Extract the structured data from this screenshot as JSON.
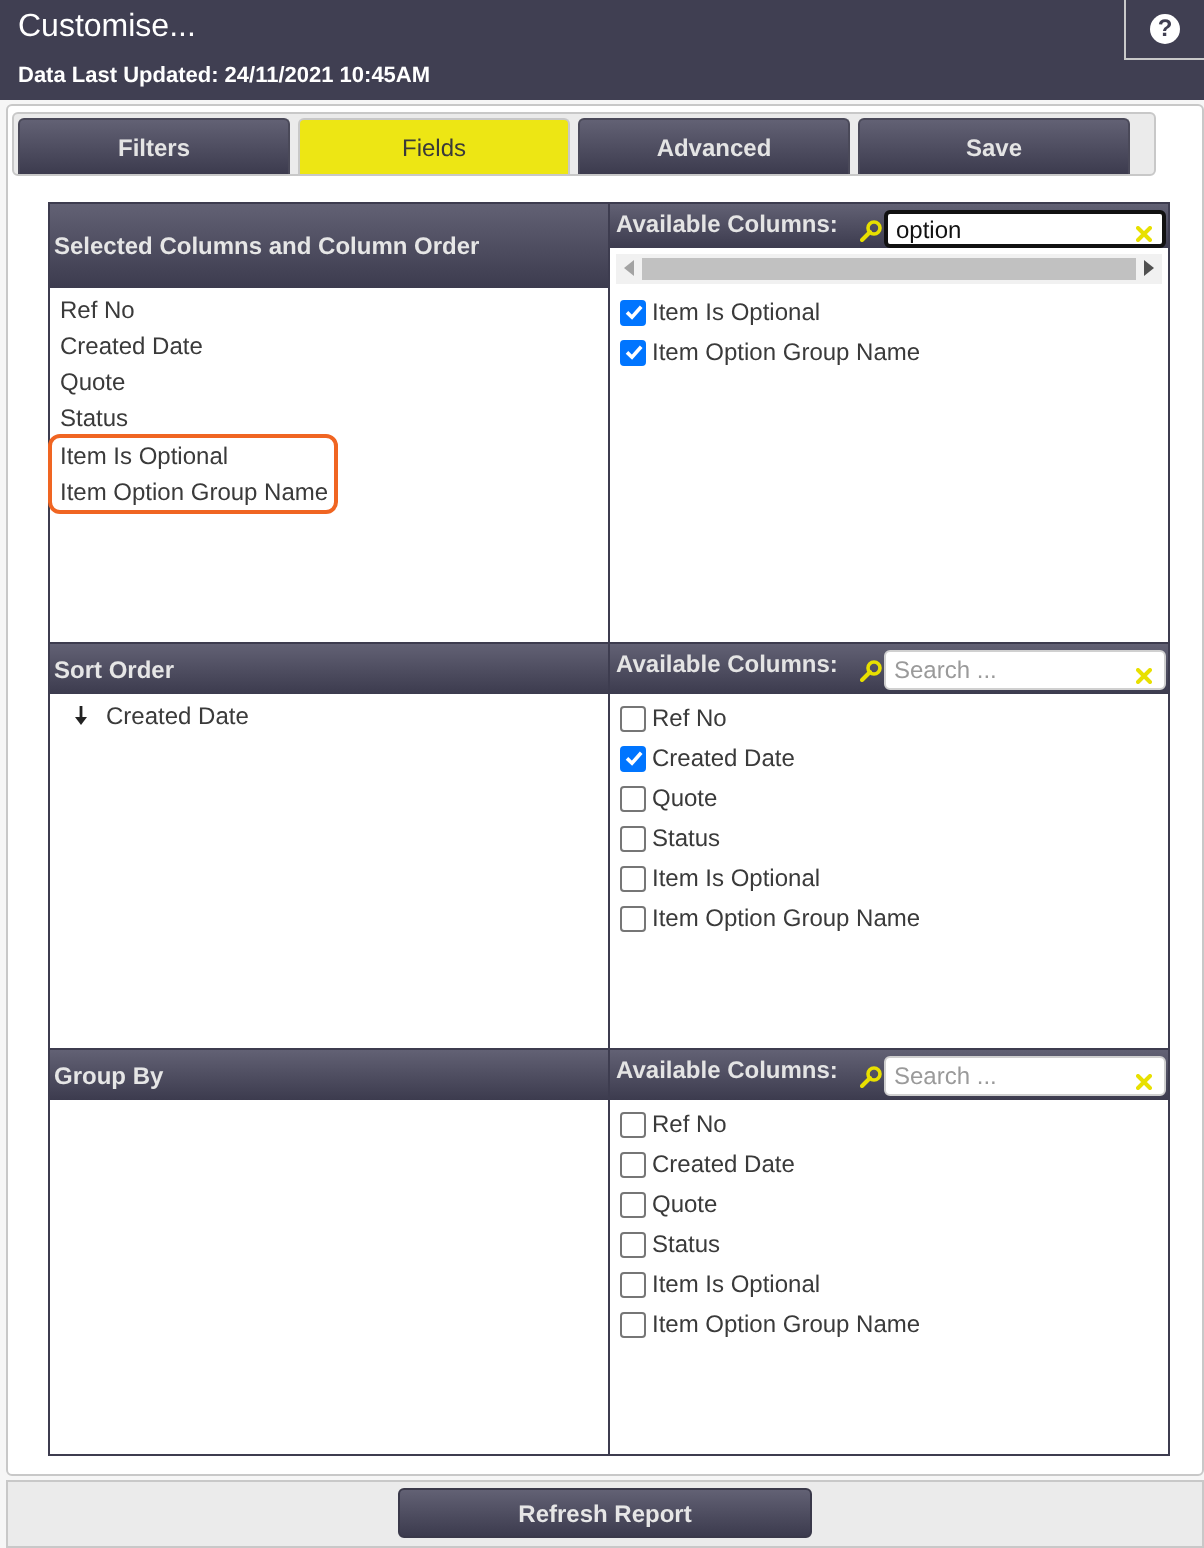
{
  "header": {
    "title": "Customise...",
    "subtitle": "Data Last Updated: 24/11/2021 10:45AM",
    "help": "?"
  },
  "tabs": [
    {
      "label": "Filters",
      "selected": false
    },
    {
      "label": "Fields",
      "selected": true
    },
    {
      "label": "Advanced",
      "selected": false
    },
    {
      "label": "Save",
      "selected": false
    }
  ],
  "sections": [
    {
      "title": "Selected Columns and Column Order",
      "items": [
        {
          "kind": "column",
          "label": "Ref No",
          "highlighted": false
        },
        {
          "kind": "column",
          "label": "Created Date",
          "highlighted": false
        },
        {
          "kind": "column",
          "label": "Quote",
          "highlighted": false
        },
        {
          "kind": "column",
          "label": "Status",
          "highlighted": false
        },
        {
          "kind": "column",
          "label": "Item Is Optional",
          "highlighted": true
        },
        {
          "kind": "column",
          "label": "Item Option Group Name",
          "highlighted": true
        }
      ],
      "available": {
        "label": "Available Columns:",
        "search": {
          "value": "option",
          "focused": true
        },
        "scrollbar": true,
        "options": [
          {
            "label": "Item Is Optional",
            "checked": true
          },
          {
            "label": "Item Option Group Name",
            "checked": true
          }
        ]
      }
    },
    {
      "title": "Sort Order",
      "items": [
        {
          "kind": "sort",
          "label": "Created Date",
          "descending": true
        }
      ],
      "available": {
        "label": "Available Columns:",
        "search": {
          "placeholder": "Search ...",
          "focused": false
        },
        "options": [
          {
            "label": "Ref No",
            "checked": false
          },
          {
            "label": "Created Date",
            "checked": true
          },
          {
            "label": "Quote",
            "checked": false
          },
          {
            "label": "Status",
            "checked": false
          },
          {
            "label": "Item Is Optional",
            "checked": false
          },
          {
            "label": "Item Option Group Name",
            "checked": false
          }
        ]
      }
    },
    {
      "title": "Group By",
      "available": {
        "label": "Available Columns:",
        "search": {
          "placeholder": "Search ...",
          "focused": false
        },
        "options": [
          {
            "label": "Ref No",
            "checked": false
          },
          {
            "label": "Created Date",
            "checked": false
          },
          {
            "label": "Quote",
            "checked": false
          },
          {
            "label": "Status",
            "checked": false
          },
          {
            "label": "Item Is Optional",
            "checked": false
          },
          {
            "label": "Item Option Group Name",
            "checked": false
          }
        ]
      }
    }
  ],
  "footer": {
    "button": "Refresh Report"
  }
}
